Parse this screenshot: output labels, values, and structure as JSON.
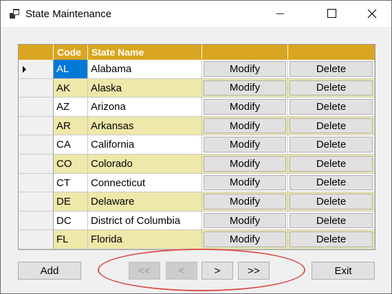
{
  "window": {
    "title": "State Maintenance"
  },
  "grid": {
    "columns": [
      "Code",
      "State Name",
      "",
      ""
    ],
    "rows": [
      {
        "code": "AL",
        "name": "Alabama",
        "modify": "Modify",
        "delete": "Delete"
      },
      {
        "code": "AK",
        "name": "Alaska",
        "modify": "Modify",
        "delete": "Delete"
      },
      {
        "code": "AZ",
        "name": "Arizona",
        "modify": "Modify",
        "delete": "Delete"
      },
      {
        "code": "AR",
        "name": "Arkansas",
        "modify": "Modify",
        "delete": "Delete"
      },
      {
        "code": "CA",
        "name": "California",
        "modify": "Modify",
        "delete": "Delete"
      },
      {
        "code": "CO",
        "name": "Colorado",
        "modify": "Modify",
        "delete": "Delete"
      },
      {
        "code": "CT",
        "name": "Connecticut",
        "modify": "Modify",
        "delete": "Delete"
      },
      {
        "code": "DE",
        "name": "Delaware",
        "modify": "Modify",
        "delete": "Delete"
      },
      {
        "code": "DC",
        "name": "District of Columbia",
        "modify": "Modify",
        "delete": "Delete"
      },
      {
        "code": "FL",
        "name": "Florida",
        "modify": "Modify",
        "delete": "Delete"
      }
    ]
  },
  "buttons": {
    "add": "Add",
    "first": "<<",
    "prev": "<",
    "next": ">",
    "last": ">>",
    "exit": "Exit"
  },
  "colors": {
    "header": "#daa520",
    "alt_row": "#eee8aa",
    "selection": "#0078d7",
    "highlight_oval": "#d9534f"
  },
  "icons": {
    "app": "app-window-icon",
    "minimize": "minimize-icon",
    "maximize": "maximize-icon",
    "close": "close-icon",
    "current_row": "row-pointer-icon"
  }
}
